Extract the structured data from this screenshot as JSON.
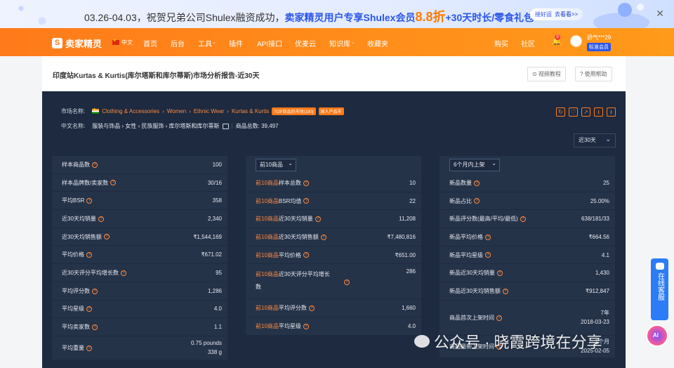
{
  "banner": {
    "part1": "03.26-04.03，祝贺兄弟公司Shulex融资成功，",
    "part2": "卖家精灵用户专享Shulex会员",
    "discount": "8.8折",
    "part3": "+30天时长/零食礼包",
    "pill_text": "接好运",
    "pill_go": "去看看>>",
    "close": "✕"
  },
  "nav": {
    "logo": "卖家精灵",
    "logo_mark": "S",
    "lang": "中文",
    "items": [
      "首页",
      "后台",
      "工具",
      "插件",
      "API接口",
      "优麦云",
      "知识库",
      "收藏夹"
    ],
    "right_items": [
      "购买",
      "社区"
    ],
    "bell_count": "0",
    "user_name": "骄气***29",
    "user_badge": "标准会员"
  },
  "header": {
    "title": "印度站Kurtas & Kurtis(库尔塔斯和库尔蒂斯)市场分析报告-近30天",
    "video_btn": "视频教程",
    "help_btn": "使用帮助"
  },
  "panel": {
    "market_label": "市场名称:",
    "crumbs": [
      "Clothing & Accessories",
      "Women",
      "Ethnic Wear",
      "Kurtas & Kurtis"
    ],
    "tag1": "TOP商品的市场(100)",
    "tag2": "国人产品市",
    "cn_label": "中文名称:",
    "cn_crumbs": "服装与饰品 › 女性 › 民族服饰 › 库尔塔斯和库尔蒂斯",
    "total_label": "商品总数: 39,497",
    "period": "近30天"
  },
  "col1": {
    "rows": [
      {
        "label": "样本商品数",
        "value": "100"
      },
      {
        "label": "样本品牌数/卖家数",
        "value": "30/16"
      },
      {
        "label": "平均BSR",
        "value": "358"
      },
      {
        "label": "近30天均销量",
        "value": "2,340"
      },
      {
        "label": "近30天均销售额",
        "value": "₹1,544,169"
      },
      {
        "label": "平均价格",
        "value": "₹671.02"
      },
      {
        "label": "近30天评分平均增长数",
        "value": "95"
      },
      {
        "label": "平均评分数",
        "value": "1,286"
      },
      {
        "label": "平均星级",
        "value": "4.0"
      },
      {
        "label": "平均卖家数",
        "value": "1.1"
      }
    ],
    "weight_label": "平均重量",
    "weight_value1": "0.75 pounds",
    "weight_value2": "338 g"
  },
  "col2": {
    "dropdown": "前10商品",
    "prefix": "前10商品",
    "rows": [
      {
        "label": "样本总数",
        "value": "10"
      },
      {
        "label": "BSR均值",
        "value": "22"
      },
      {
        "label": "近30天均销量",
        "value": "11,208"
      },
      {
        "label": "近30天均销售额",
        "value": "₹7,480,816"
      },
      {
        "label": "平均价格",
        "value": "₹651.00"
      }
    ],
    "tall_label_a": "近30天评分平均增长",
    "tall_label_b": "数",
    "tall_value": "286",
    "rows_after": [
      {
        "label": "平均评分数",
        "value": "1,660"
      },
      {
        "label": "平均星级",
        "value": "4.0"
      }
    ]
  },
  "col3": {
    "dropdown": "6个月内上架",
    "rows": [
      {
        "label": "新品数量",
        "value": "25"
      },
      {
        "label": "新品占比",
        "value": "25.00%"
      },
      {
        "label": "新品评分数(最高/平均/最低)",
        "value": "638/181/33"
      },
      {
        "label": "新品平均价格",
        "value": "₹664.56"
      },
      {
        "label": "新品平均星级",
        "value": "4.1"
      },
      {
        "label": "新品近30天均销量",
        "value": "1,430"
      },
      {
        "label": "新品近30天均销售额",
        "value": "₹912,847"
      }
    ],
    "first_label": "商品首次上架时间",
    "first_value1": "7年",
    "first_value2": "2018-03-23",
    "latest_label": "商品最新上架时间",
    "latest_value1": "1个月",
    "latest_value2": "2025-02-05"
  },
  "floating": {
    "service": "在线客服",
    "watermark": "公众号 · 晓霞跨境在分享"
  }
}
